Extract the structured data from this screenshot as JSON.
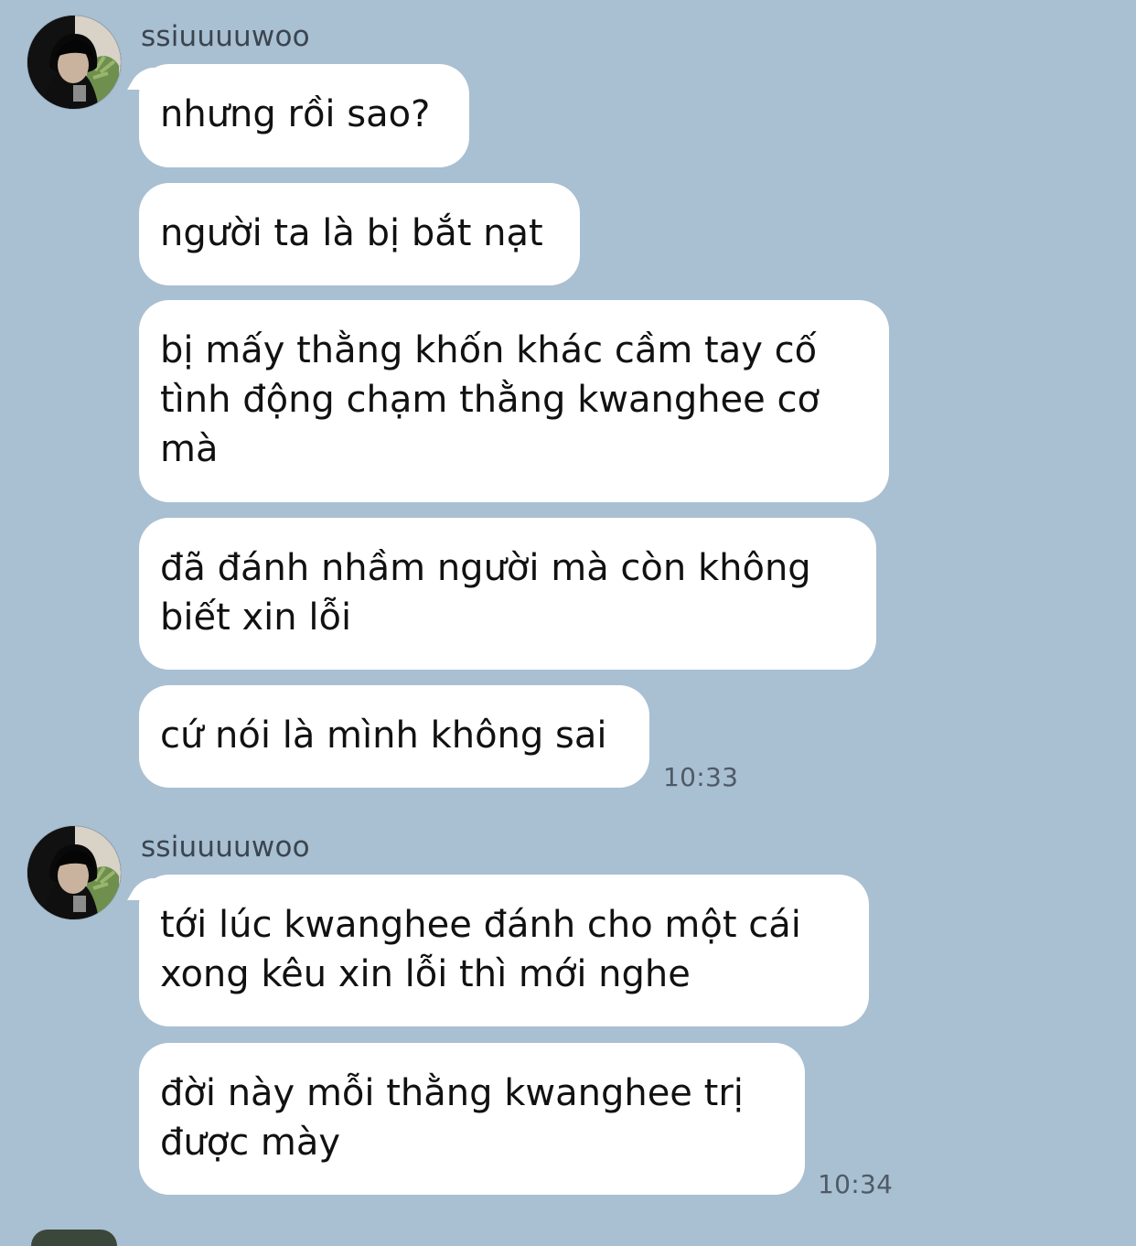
{
  "theme": {
    "background": "#a9bfd2",
    "bubble_color": "#ffffff",
    "text_color": "#111111",
    "meta_color": "#4e5a66"
  },
  "groups": [
    {
      "sender": "ssiuuuuwoo",
      "avatar_icon": "user-avatar-icon",
      "messages": [
        "nhưng rồi sao?",
        "người ta là bị bắt nạt",
        "bị mấy thằng khốn khác cầm tay cố tình động chạm thằng kwanghee cơ mà",
        "đã đánh nhầm người mà còn không biết xin lỗi",
        "cứ nói là mình không sai"
      ],
      "time": "10:33"
    },
    {
      "sender": "ssiuuuuwoo",
      "avatar_icon": "user-avatar-icon",
      "messages": [
        "tới lúc kwanghee đánh cho một cái xong kêu xin lỗi thì mới nghe",
        "đời này mỗi thằng kwanghee trị được mày"
      ],
      "time": "10:34"
    }
  ]
}
